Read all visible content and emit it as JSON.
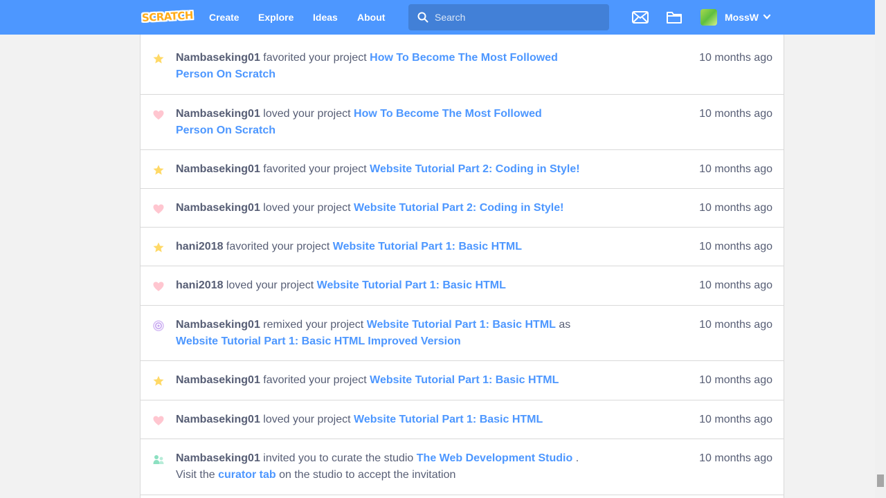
{
  "nav": {
    "logo": "SCRATCH",
    "links": [
      "Create",
      "Explore",
      "Ideas",
      "About"
    ],
    "search_placeholder": "Search",
    "username": "MossW"
  },
  "colors": {
    "brand": "#4d97ff",
    "link": "#4d97ff",
    "text": "#575e75",
    "star": "#ffd966",
    "heart": "#ffc0cb",
    "remix": "#c5a3f0",
    "curator": "#8ce0c1"
  },
  "messages": [
    {
      "icon": "star-icon",
      "actor": "Nambaseking01",
      "verb": " favorited your project ",
      "link": "How To Become The Most Followed Person On Scratch",
      "time": "10 months ago"
    },
    {
      "icon": "heart-icon",
      "actor": "Nambaseking01",
      "verb": " loved your project ",
      "link": "How To Become The Most Followed Person On Scratch",
      "time": "10 months ago"
    },
    {
      "icon": "star-icon",
      "actor": "Nambaseking01",
      "verb": " favorited your project ",
      "link": "Website Tutorial Part 2: Coding in Style!",
      "time": "10 months ago"
    },
    {
      "icon": "heart-icon",
      "actor": "Nambaseking01",
      "verb": " loved your project ",
      "link": "Website Tutorial Part 2: Coding in Style!",
      "time": "10 months ago"
    },
    {
      "icon": "star-icon",
      "actor": "hani2018",
      "verb": " favorited your project ",
      "link": "Website Tutorial Part 1: Basic HTML",
      "time": "10 months ago"
    },
    {
      "icon": "heart-icon",
      "actor": "hani2018",
      "verb": " loved your project ",
      "link": "Website Tutorial Part 1: Basic HTML",
      "time": "10 months ago"
    },
    {
      "icon": "remix-icon",
      "actor": "Nambaseking01",
      "verb": " remixed your project ",
      "link": "Website Tutorial Part 1: Basic HTML",
      "middle": " as ",
      "link2": "Website Tutorial Part 1: Basic HTML Improved Version",
      "time": "10 months ago"
    },
    {
      "icon": "star-icon",
      "actor": "Nambaseking01",
      "verb": " favorited your project ",
      "link": "Website Tutorial Part 1: Basic HTML",
      "time": "10 months ago"
    },
    {
      "icon": "heart-icon",
      "actor": "Nambaseking01",
      "verb": " loved your project ",
      "link": "Website Tutorial Part 1: Basic HTML",
      "time": "10 months ago"
    },
    {
      "icon": "curator-icon",
      "actor": "Nambaseking01",
      "verb": " invited you to curate the studio ",
      "link": "The Web Development Studio",
      "middle": " . Visit the ",
      "link2": "curator tab",
      "tail": " on the studio to accept the invitation",
      "time": "10 months ago"
    }
  ]
}
